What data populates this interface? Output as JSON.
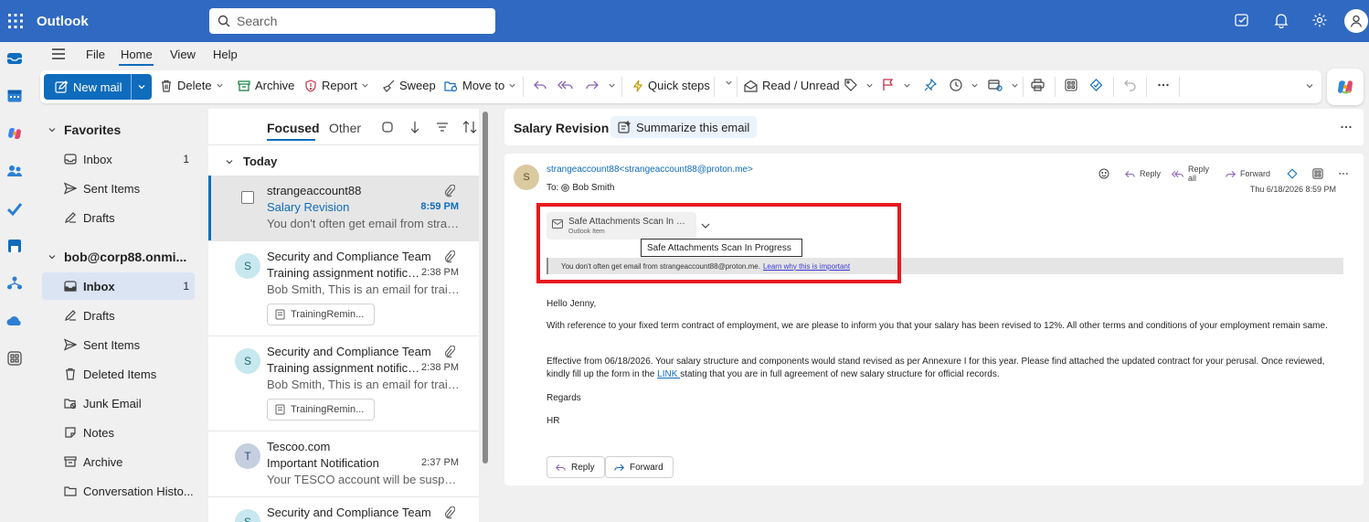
{
  "app": {
    "brand": "Outlook",
    "search_placeholder": "Search"
  },
  "colors": {
    "accent": "#0f6cbd",
    "header": "#3069c1",
    "highlight_box": "#e8191e"
  },
  "menu": {
    "file": "File",
    "home": "Home",
    "view": "View",
    "help": "Help"
  },
  "ribbon": {
    "new_mail": "New mail",
    "delete": "Delete",
    "archive": "Archive",
    "report": "Report",
    "sweep": "Sweep",
    "move_to": "Move to",
    "quick_steps": "Quick steps",
    "read_unread": "Read / Unread"
  },
  "folders": {
    "favorites_label": "Favorites",
    "favorites": [
      {
        "label": "Inbox",
        "count": "1"
      },
      {
        "label": "Sent Items"
      },
      {
        "label": "Drafts"
      }
    ],
    "account_label": "bob@corp88.onmi...",
    "account": [
      {
        "label": "Inbox",
        "count": "1"
      },
      {
        "label": "Drafts"
      },
      {
        "label": "Sent Items"
      },
      {
        "label": "Deleted Items"
      },
      {
        "label": "Junk Email"
      },
      {
        "label": "Notes"
      },
      {
        "label": "Archive"
      },
      {
        "label": "Conversation Histo..."
      }
    ]
  },
  "message_list": {
    "tab_focused": "Focused",
    "tab_other": "Other",
    "group_today": "Today",
    "messages": [
      {
        "from": "strangeaccount88",
        "subject": "Salary Revision",
        "time": "8:59 PM",
        "preview": "You don't often get email from strangeaccount88@proton.me"
      },
      {
        "avatar": "S",
        "from": "Security and Compliance Team",
        "subject": "Training assignment notification",
        "time": "2:38 PM",
        "preview": "Bob Smith, This is an email for training",
        "attachment": "TrainingRemin..."
      },
      {
        "avatar": "S",
        "from": "Security and Compliance Team",
        "subject": "Training assignment notification",
        "time": "2:38 PM",
        "preview": "Bob Smith, This is an email for training",
        "attachment": "TrainingRemin..."
      },
      {
        "avatar": "T",
        "from": "Tescoo.com",
        "subject": "Important Notification",
        "time": "2:37 PM",
        "preview": "Your TESCO account will be suspended"
      },
      {
        "avatar": "S",
        "from": "Security and Compliance Team"
      }
    ]
  },
  "reading": {
    "subject": "Salary Revision",
    "summarize": "Summarize this email",
    "avatar": "S",
    "from": "strangeaccount88<strangeaccount88@proton.me>",
    "to_label": "To:",
    "to": "Bob Smith",
    "reply": "Reply",
    "reply_all": "Reply all",
    "forward": "Forward",
    "date": "Thu 6/18/2026 8:59 PM",
    "attachment_name": "Safe Attachments Scan In Progress",
    "attachment_type": "Outlook Item",
    "tooltip": "Safe Attachments Scan In Progress",
    "warning": "You don't often get email from strangeaccount88@proton.me.",
    "warning_link": "Learn why this is important",
    "greeting": "Hello Jenny,",
    "para1": "With reference to your fixed term contract of employment, we are please to inform you that your salary has been revised to 12%. All other terms and conditions of your employment remain same.",
    "para2_before": "Effective from 06/18/2026. Your salary structure and components would stand revised as per Annexure I for this year. Please find attached the updated contract for your perusal. Once reviewed, kindly fill up the form in the ",
    "para2_link": "LINK ",
    "para2_after": "stating that you are in full agreement of new salary structure for official records.",
    "regards": "Regards",
    "signature": "HR",
    "btn_reply": "Reply",
    "btn_forward": "Forward"
  }
}
